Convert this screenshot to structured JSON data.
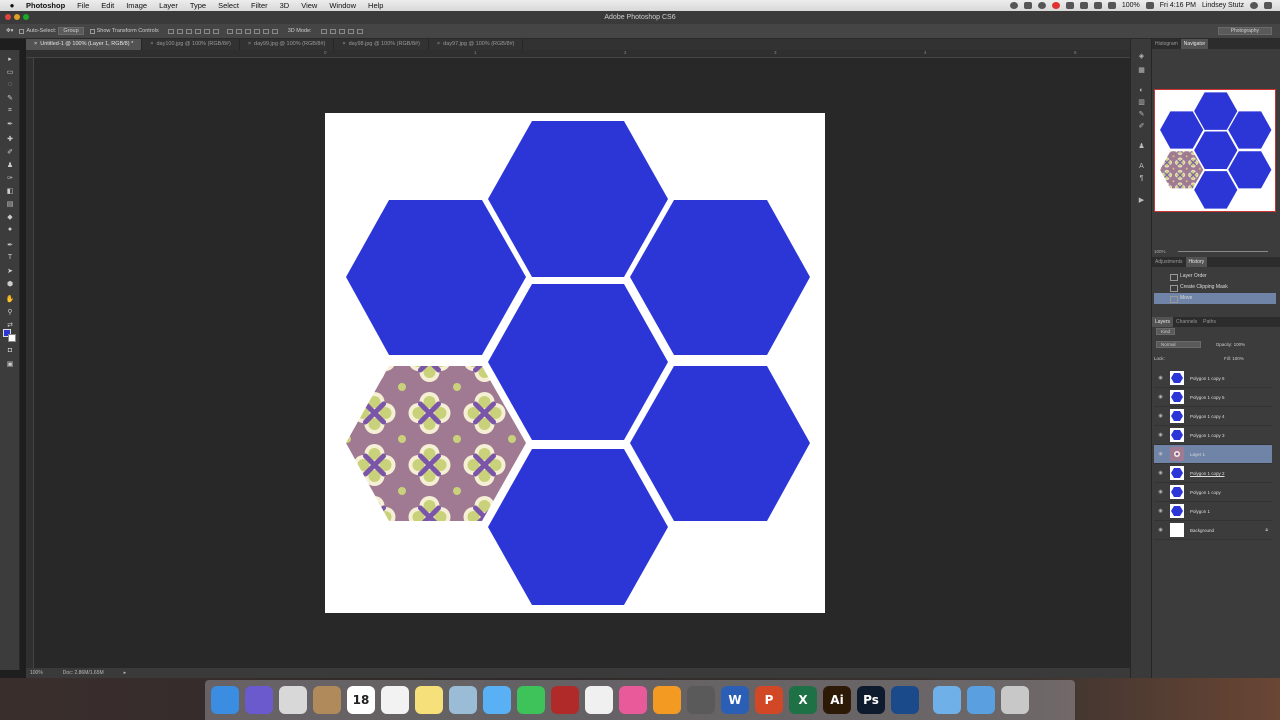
{
  "menubar": {
    "app": "Photoshop",
    "items": [
      "File",
      "Edit",
      "Image",
      "Layer",
      "Type",
      "Select",
      "Filter",
      "3D",
      "View",
      "Window",
      "Help"
    ],
    "battery": "100%",
    "clock": "Fri 4:16 PM",
    "user": "Lindsey Stutz"
  },
  "window": {
    "title": "Adobe Photoshop CS6"
  },
  "options": {
    "auto_select_label": "Auto-Select:",
    "auto_select_value": "Group",
    "transform_label": "Show Transform Controls",
    "mode_label": "3D Mode:",
    "workspace": "Photography"
  },
  "tabs": [
    {
      "label": "Untitled-1 @ 100% (Layer 1, RGB/8) *",
      "active": true
    },
    {
      "label": "day100.jpg @ 100% (RGB/8#)",
      "active": false
    },
    {
      "label": "day99.jpg @ 100% (RGB/8#)",
      "active": false
    },
    {
      "label": "day98.jpg @ 100% (RGB/8#)",
      "active": false
    },
    {
      "label": "day97.jpg @ 100% (RGB/8#)",
      "active": false
    }
  ],
  "ruler": {
    "ticks": [
      "0",
      "1",
      "2",
      "3",
      "4",
      "5"
    ]
  },
  "status": {
    "zoom": "100%",
    "doc": "Doc: 2.86M/1.65M"
  },
  "panels": {
    "top_tabs": [
      "Histogram",
      "Navigator"
    ],
    "nav_zoom": "100%",
    "mid_tabs": [
      "Adjustments",
      "History"
    ],
    "history": [
      "Layer Order",
      "Create Clipping Mask",
      "Move"
    ],
    "layer_tabs": [
      "Layers",
      "Channels",
      "Paths"
    ],
    "kind": "Kind",
    "blend_mode": "Normal",
    "opacity_label": "Opacity:",
    "opacity_value": "100%",
    "lock_label": "Lock:",
    "fill_label": "Fill:",
    "fill_value": "100%",
    "layers": [
      {
        "name": "Polygon 1 copy 6",
        "type": "shape",
        "active": false
      },
      {
        "name": "Polygon 1 copy 5",
        "type": "shape",
        "active": false
      },
      {
        "name": "Polygon 1 copy 4",
        "type": "shape",
        "active": false
      },
      {
        "name": "Polygon 1 copy 3",
        "type": "shape",
        "active": false
      },
      {
        "name": "Layer 1",
        "type": "pattern",
        "active": true
      },
      {
        "name": "Polygon 1 copy 2",
        "type": "shape",
        "active": false
      },
      {
        "name": "Polygon 1 copy",
        "type": "shape",
        "active": false
      },
      {
        "name": "Polygon 1",
        "type": "shape",
        "active": false
      },
      {
        "name": "Background",
        "type": "background",
        "active": false
      }
    ]
  },
  "colors": {
    "hex_fill": "#2c36d6",
    "pattern_bg": "#a07a92",
    "accent": "#6f84a6"
  },
  "dock": [
    {
      "name": "finder",
      "label": "",
      "color": "#3a8de0"
    },
    {
      "name": "siri",
      "label": "",
      "color": "#6a5acd"
    },
    {
      "name": "chrome",
      "label": "",
      "color": "#d8d8d8"
    },
    {
      "name": "contacts",
      "label": "",
      "color": "#b08a5a"
    },
    {
      "name": "calendar",
      "label": "18",
      "color": "#ffffff"
    },
    {
      "name": "reminders",
      "label": "",
      "color": "#f2f2f2"
    },
    {
      "name": "notes",
      "label": "",
      "color": "#f5e07a"
    },
    {
      "name": "preview",
      "label": "",
      "color": "#9bbcd6"
    },
    {
      "name": "messages",
      "label": "",
      "color": "#5ab0f5"
    },
    {
      "name": "facetime",
      "label": "",
      "color": "#3ec25a"
    },
    {
      "name": "photo-booth",
      "label": "",
      "color": "#b02a2a"
    },
    {
      "name": "photos",
      "label": "",
      "color": "#f0f0f0"
    },
    {
      "name": "itunes",
      "label": "",
      "color": "#e85a9a"
    },
    {
      "name": "ibooks",
      "label": "",
      "color": "#f39a22"
    },
    {
      "name": "app-store",
      "label": "",
      "color": "#5a5a5a"
    },
    {
      "name": "word",
      "label": "W",
      "color": "#2b5fb5"
    },
    {
      "name": "powerpoint",
      "label": "P",
      "color": "#d24726"
    },
    {
      "name": "excel",
      "label": "X",
      "color": "#1e7145"
    },
    {
      "name": "illustrator",
      "label": "Ai",
      "color": "#2d1a06"
    },
    {
      "name": "photoshop",
      "label": "Ps",
      "color": "#0e1a2e"
    },
    {
      "name": "quicktime",
      "label": "",
      "color": "#1a4a8a"
    },
    {
      "name": "applications",
      "label": "",
      "color": "#6fb0e8"
    },
    {
      "name": "downloads",
      "label": "",
      "color": "#5aa0e0"
    },
    {
      "name": "trash",
      "label": "",
      "color": "#c8c8c8"
    }
  ]
}
